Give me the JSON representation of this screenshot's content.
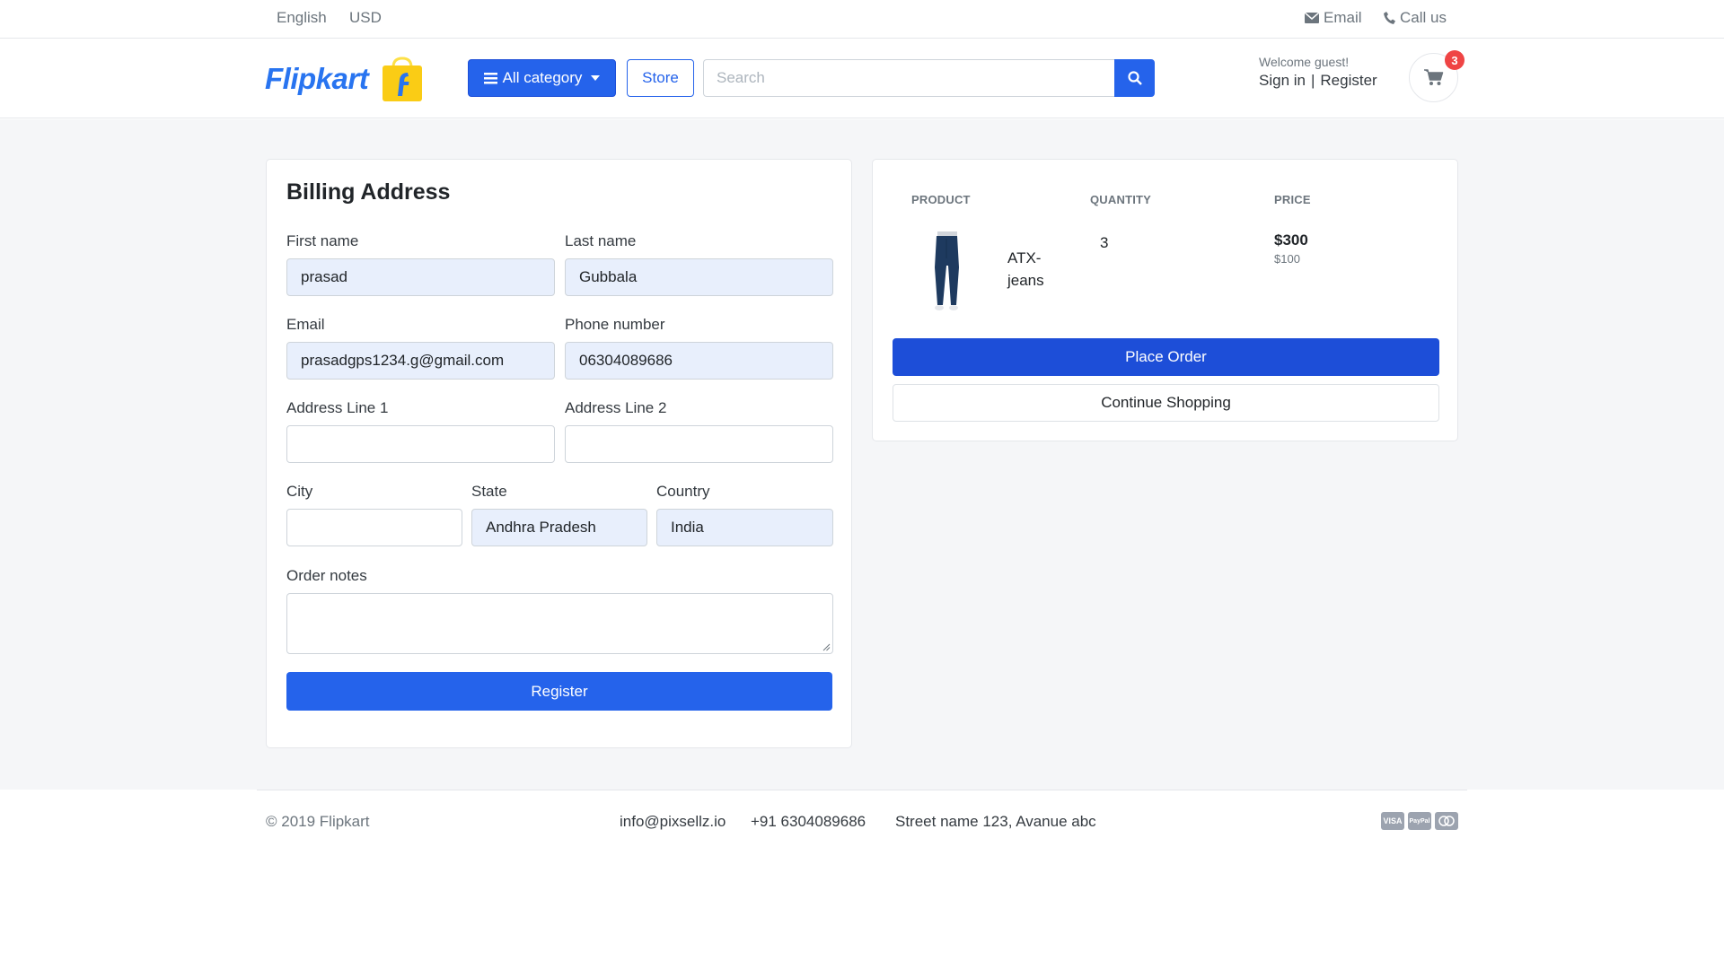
{
  "topbar": {
    "language": "English",
    "currency": "USD",
    "email_label": "Email",
    "call_label": "Call us"
  },
  "header": {
    "logo_text": "Flipkart",
    "category_label": "All category",
    "store_label": "Store",
    "search_placeholder": "Search",
    "welcome": "Welcome guest!",
    "sign_in": "Sign in",
    "separator": "|",
    "register": "Register",
    "cart_count": "3"
  },
  "billing": {
    "title": "Billing Address",
    "first_name": {
      "label": "First name",
      "value": "prasad"
    },
    "last_name": {
      "label": "Last name",
      "value": "Gubbala"
    },
    "email": {
      "label": "Email",
      "value": "prasadgps1234.g@gmail.com"
    },
    "phone": {
      "label": "Phone number",
      "value": "06304089686"
    },
    "address1": {
      "label": "Address Line 1",
      "value": ""
    },
    "address2": {
      "label": "Address Line 2",
      "value": ""
    },
    "city": {
      "label": "City",
      "value": ""
    },
    "state": {
      "label": "State",
      "value": "Andhra Pradesh"
    },
    "country": {
      "label": "Country",
      "value": "India"
    },
    "notes": {
      "label": "Order notes",
      "value": ""
    },
    "submit_label": "Register"
  },
  "order": {
    "headers": {
      "product": "PRODUCT",
      "quantity": "QUANTITY",
      "price": "PRICE"
    },
    "items": [
      {
        "name": "ATX-jeans",
        "quantity": "3",
        "price": "$300",
        "unit_price": "$100"
      }
    ],
    "place_order_label": "Place Order",
    "continue_label": "Continue Shopping"
  },
  "footer": {
    "copyright": "© 2019 Flipkart",
    "email": "info@pixsellz.io",
    "phone": "+91 6304089686",
    "address": "Street name 123, Avanue abc",
    "payments": [
      "VISA",
      "PayPal",
      "MC"
    ]
  },
  "colors": {
    "primary": "#2563eb",
    "badge": "#ef4444",
    "field_filled": "#e8effc",
    "page_bg": "#f5f6f8"
  }
}
